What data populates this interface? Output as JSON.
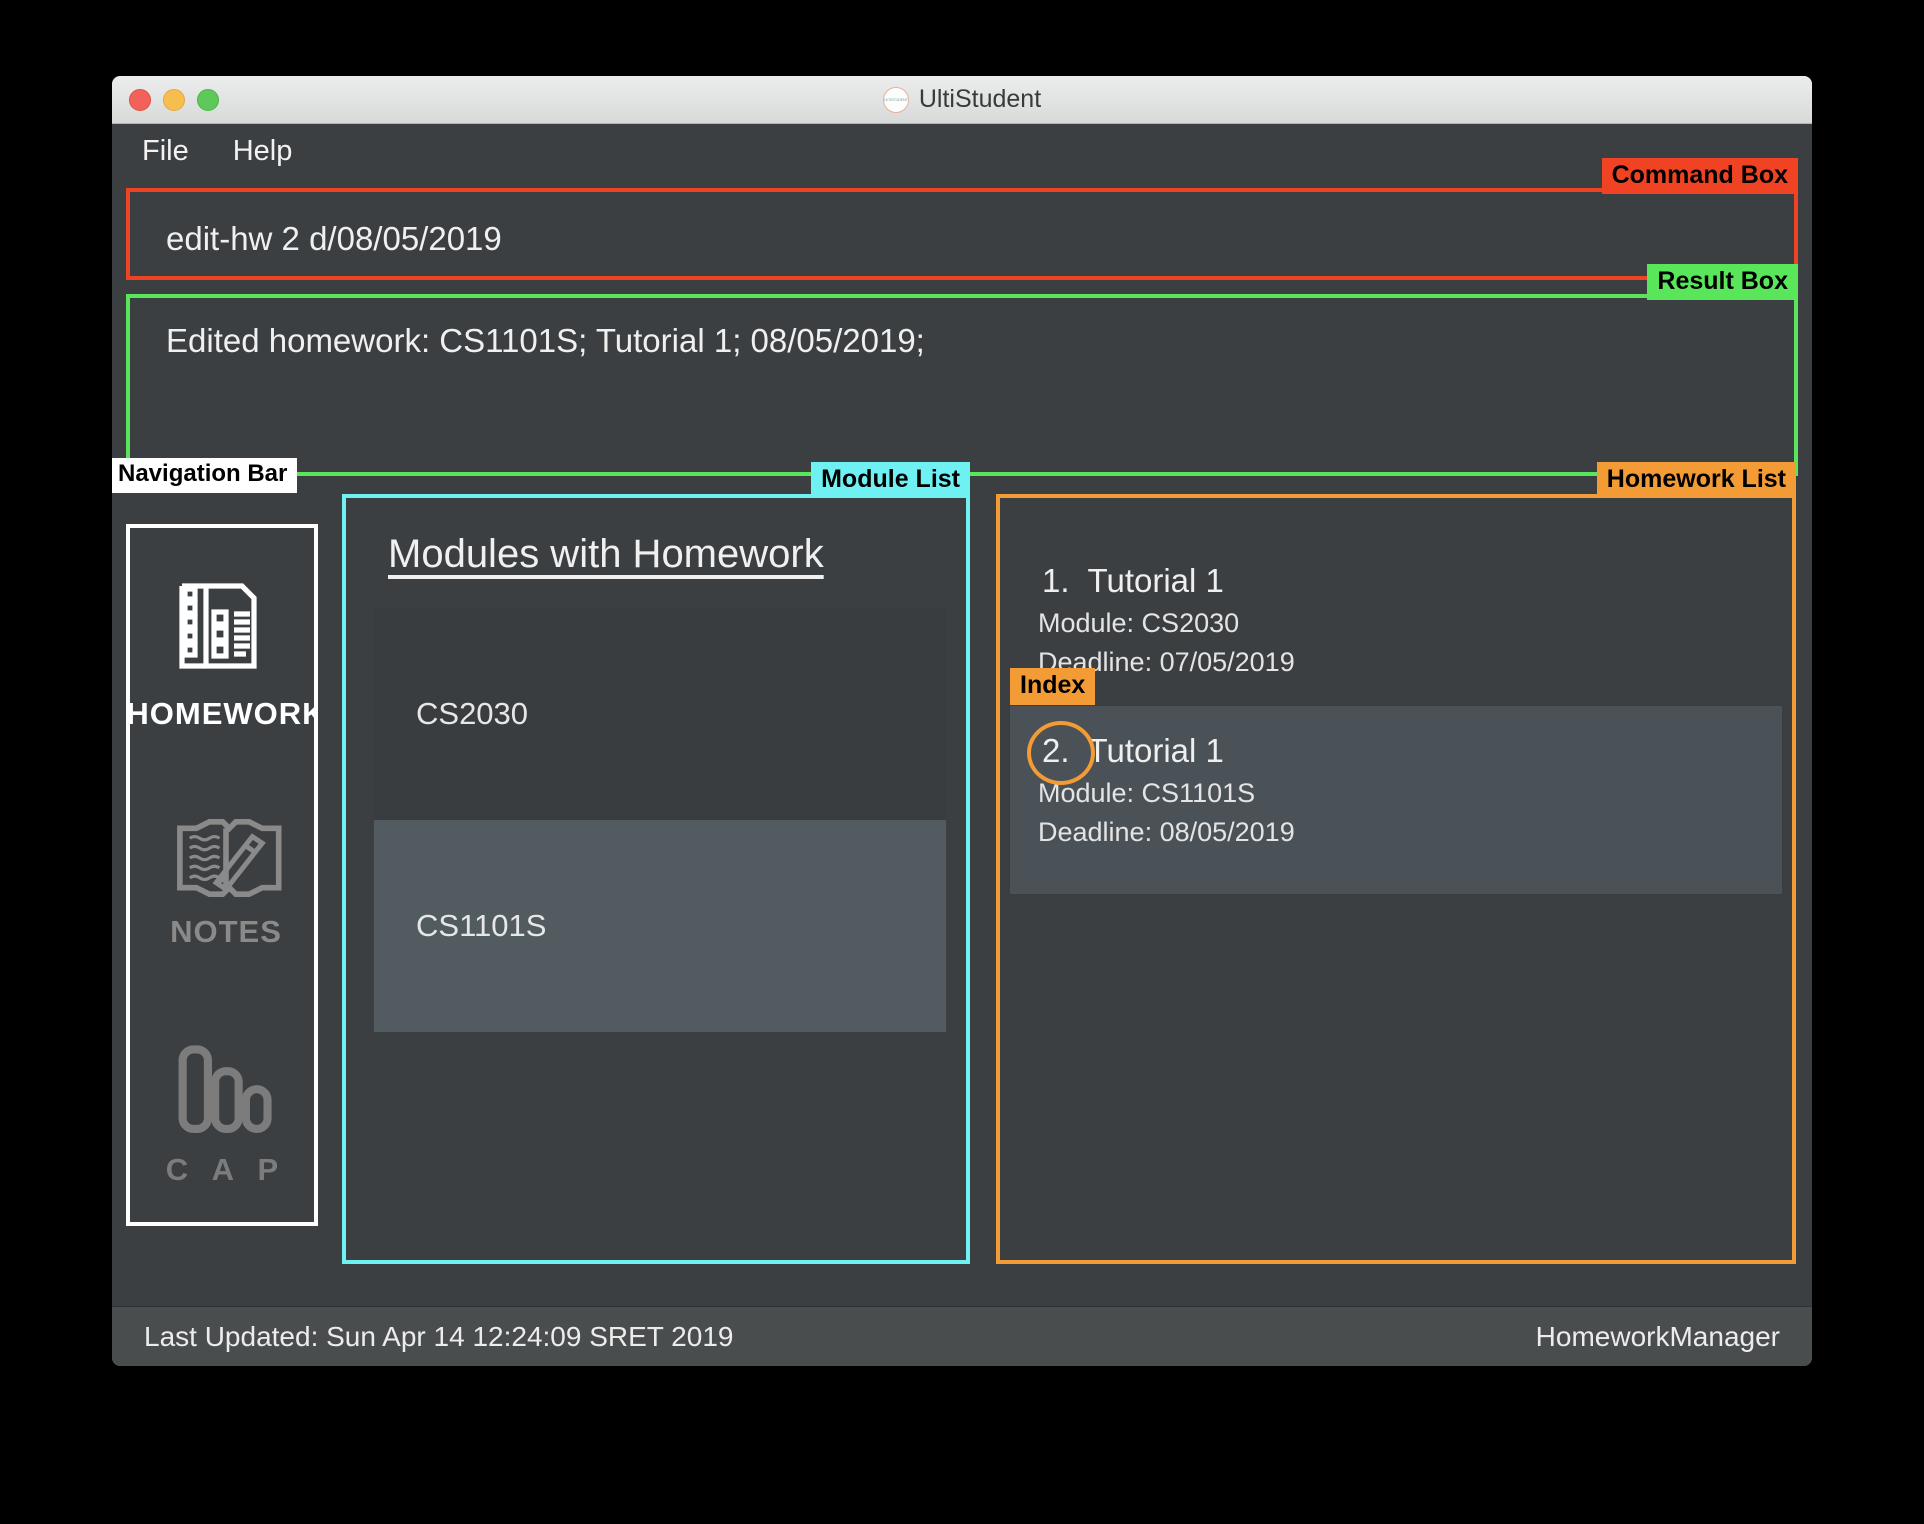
{
  "window": {
    "title": "UltiStudent",
    "logo_icon": "ultistudent-circle-logo",
    "traffic_lights": [
      "close-button",
      "minimize-button",
      "zoom-button"
    ]
  },
  "menubar": {
    "items": [
      {
        "label": "File",
        "name": "menu-file"
      },
      {
        "label": "Help",
        "name": "menu-help"
      }
    ]
  },
  "command_box": {
    "annotation": "Command Box",
    "value": "edit-hw 2 d/08/05/2019",
    "border_color": "#f04323"
  },
  "result_box": {
    "annotation": "Result Box",
    "text": "Edited homework: CS1101S; Tutorial 1; 08/05/2019;",
    "border_color": "#59e65b"
  },
  "navigation_bar": {
    "annotation": "Navigation Bar",
    "border_color": "#ffffff",
    "items": [
      {
        "label": "HOMEWORK",
        "icon": "documents-checklist-icon",
        "selected": true
      },
      {
        "label": "NOTES",
        "icon": "open-book-pen-icon",
        "selected": false
      },
      {
        "label": "C A P",
        "icon": "bar-chart-icon",
        "selected": false
      }
    ]
  },
  "module_list": {
    "annotation": "Module List",
    "border_color": "#6ff0f2",
    "heading": "Modules with Homework",
    "items": [
      {
        "code": "CS2030",
        "selected": false
      },
      {
        "code": "CS1101S",
        "selected": true
      }
    ]
  },
  "homework_list": {
    "annotation": "Homework List",
    "index_annotation": "Index",
    "border_color": "#f39b35",
    "items": [
      {
        "index": "1.",
        "name": "Tutorial 1",
        "module": "Module: CS2030",
        "deadline": "Deadline: 07/05/2019",
        "selected": false,
        "index_circled": false
      },
      {
        "index": "2.",
        "name": "Tutorial 1",
        "module": "Module: CS1101S",
        "deadline": "Deadline: 08/05/2019",
        "selected": true,
        "index_circled": true
      }
    ]
  },
  "status_bar": {
    "left": "Last Updated: Sun Apr 14 12:24:09 SRET 2019",
    "right": "HomeworkManager"
  }
}
